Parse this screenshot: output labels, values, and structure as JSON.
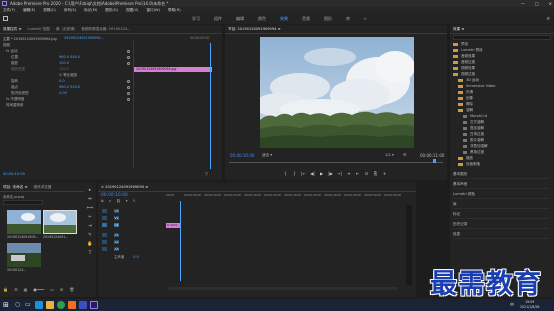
{
  "window": {
    "title": "Adobe Premiere Pro 2020 - C:\\用户\\Fsbiql\\文档\\Adobe\\Premiere Pro\\14.0\\未命名 *",
    "controls": [
      "—",
      "□",
      "✕"
    ]
  },
  "menu": [
    "文件(F)",
    "编辑(E)",
    "剪辑(C)",
    "序列(S)",
    "标记(M)",
    "图形(G)",
    "视图(V)",
    "窗口(W)",
    "帮助(H)"
  ],
  "workspaces": {
    "tabs": [
      "学习",
      "组件",
      "编辑",
      "颜色",
      "效果",
      "音频",
      "图形",
      "库"
    ],
    "active_index": 4,
    "more": "»"
  },
  "effect_controls": {
    "tabs": [
      "效果控件 ≡",
      "Lumetri 范围",
      "源: (无剪辑)",
      "音频剪辑混合器: 20190124..."
    ],
    "source_label": "主要 * 20190124091909094.jpg",
    "clip_label": "20190124091909094...",
    "ruler": "00:00:05:00",
    "clip_bar": "20190124091909094.jpg",
    "rows": [
      {
        "indent": 0,
        "label": "视频",
        "value": ""
      },
      {
        "indent": 1,
        "label": "fx 运动",
        "value": ""
      },
      {
        "indent": 2,
        "label": "位置",
        "value": "960.0  540.0"
      },
      {
        "indent": 2,
        "label": "缩放",
        "value": "100.0"
      },
      {
        "indent": 2,
        "label": "缩放宽度",
        "value": "100.0"
      },
      {
        "indent": 2,
        "label": "",
        "value": "☑ 等比缩放"
      },
      {
        "indent": 2,
        "label": "旋转",
        "value": "0.0"
      },
      {
        "indent": 2,
        "label": "锚点",
        "value": "960.0  540.0"
      },
      {
        "indent": 2,
        "label": "防闪烁滤镜",
        "value": "0.00"
      },
      {
        "indent": 1,
        "label": "fx 不透明度",
        "value": ""
      },
      {
        "indent": 1,
        "label": "时间重映射",
        "value": ""
      }
    ],
    "footer_timecode": "00:00:10:00"
  },
  "program_monitor": {
    "title": "节目: 20190124091909094 ≡",
    "timecode": "00:00:10:00",
    "fit": "适合",
    "ratio": "1/2",
    "duration": "00:00:11:00",
    "transport": [
      "{",
      "}",
      "|←",
      "◀|",
      "▶",
      "|▶",
      "→|",
      "⇥",
      "⇤",
      "⊡",
      "⎘",
      "+"
    ]
  },
  "project_panel": {
    "title": "项目: 未命名 ≡",
    "tab2": "媒体浏览器",
    "path": "未命名.prproj",
    "clips": [
      {
        "name": "20190124091909...",
        "dur": "5:00",
        "sky": true
      },
      {
        "name": "20190124091...",
        "dur": "5:00",
        "sky": false
      },
      {
        "name": "20190124...",
        "dur": "5:00",
        "sky": false
      }
    ]
  },
  "effects_panel": {
    "title": "效果 ≡",
    "items": [
      {
        "indent": 0,
        "type": "folder",
        "label": "预设"
      },
      {
        "indent": 0,
        "type": "folder",
        "label": "Lumetri 预设"
      },
      {
        "indent": 0,
        "type": "folder",
        "label": "音频效果"
      },
      {
        "indent": 0,
        "type": "folder",
        "label": "音频过渡"
      },
      {
        "indent": 0,
        "type": "folder",
        "label": "视频效果"
      },
      {
        "indent": 0,
        "type": "folder",
        "label": "视频过渡"
      },
      {
        "indent": 1,
        "type": "folder",
        "label": "3D 运动"
      },
      {
        "indent": 1,
        "type": "folder",
        "label": "Immersive Video"
      },
      {
        "indent": 1,
        "type": "folder",
        "label": "内滑"
      },
      {
        "indent": 1,
        "type": "folder",
        "label": "划像"
      },
      {
        "indent": 1,
        "type": "folder",
        "label": "擦除"
      },
      {
        "indent": 1,
        "type": "folder",
        "label": "溶解"
      },
      {
        "indent": 2,
        "type": "item",
        "label": "MorphCut"
      },
      {
        "indent": 2,
        "type": "item",
        "label": "交叉溶解"
      },
      {
        "indent": 2,
        "type": "item",
        "label": "叠加溶解"
      },
      {
        "indent": 2,
        "type": "item",
        "label": "白场过渡"
      },
      {
        "indent": 2,
        "type": "item",
        "label": "胶片溶解"
      },
      {
        "indent": 2,
        "type": "item",
        "label": "非叠加溶解"
      },
      {
        "indent": 2,
        "type": "item",
        "label": "黑场过渡"
      },
      {
        "indent": 1,
        "type": "folder",
        "label": "缩放"
      },
      {
        "indent": 1,
        "type": "folder",
        "label": "页面剥落"
      }
    ],
    "sections": [
      "基本图形",
      "基本声音",
      "Lumetri 颜色",
      "库",
      "标记",
      "历史记录",
      "信息"
    ]
  },
  "timeline": {
    "title": "× 20190124091909094 ≡",
    "timecode": "00:00:10:00",
    "ruler": [
      "00:00",
      "00:00:05:00",
      "00:00:10:00",
      "00:00:15:00",
      "00:00:20:00",
      "00:00:25:00",
      "00:00:30:00",
      "00:00:35:00",
      "00:00:40:00",
      "00:00:45:00",
      "00:00:50:00",
      "00:00:55:00"
    ],
    "tracks": [
      "V3",
      "V2",
      "V1",
      "A1",
      "A2",
      "A3"
    ],
    "master": "主声道",
    "master_value": "0.0",
    "clip_label": "fx 2019..."
  },
  "tools": [
    "▸",
    "⇹",
    "⟺",
    "✂",
    "⇥",
    "✎",
    "✋",
    "T"
  ],
  "taskbar": {
    "time": "19:09",
    "date": "2021/1/6/26",
    "lang": "中"
  },
  "watermark": "最需教育"
}
